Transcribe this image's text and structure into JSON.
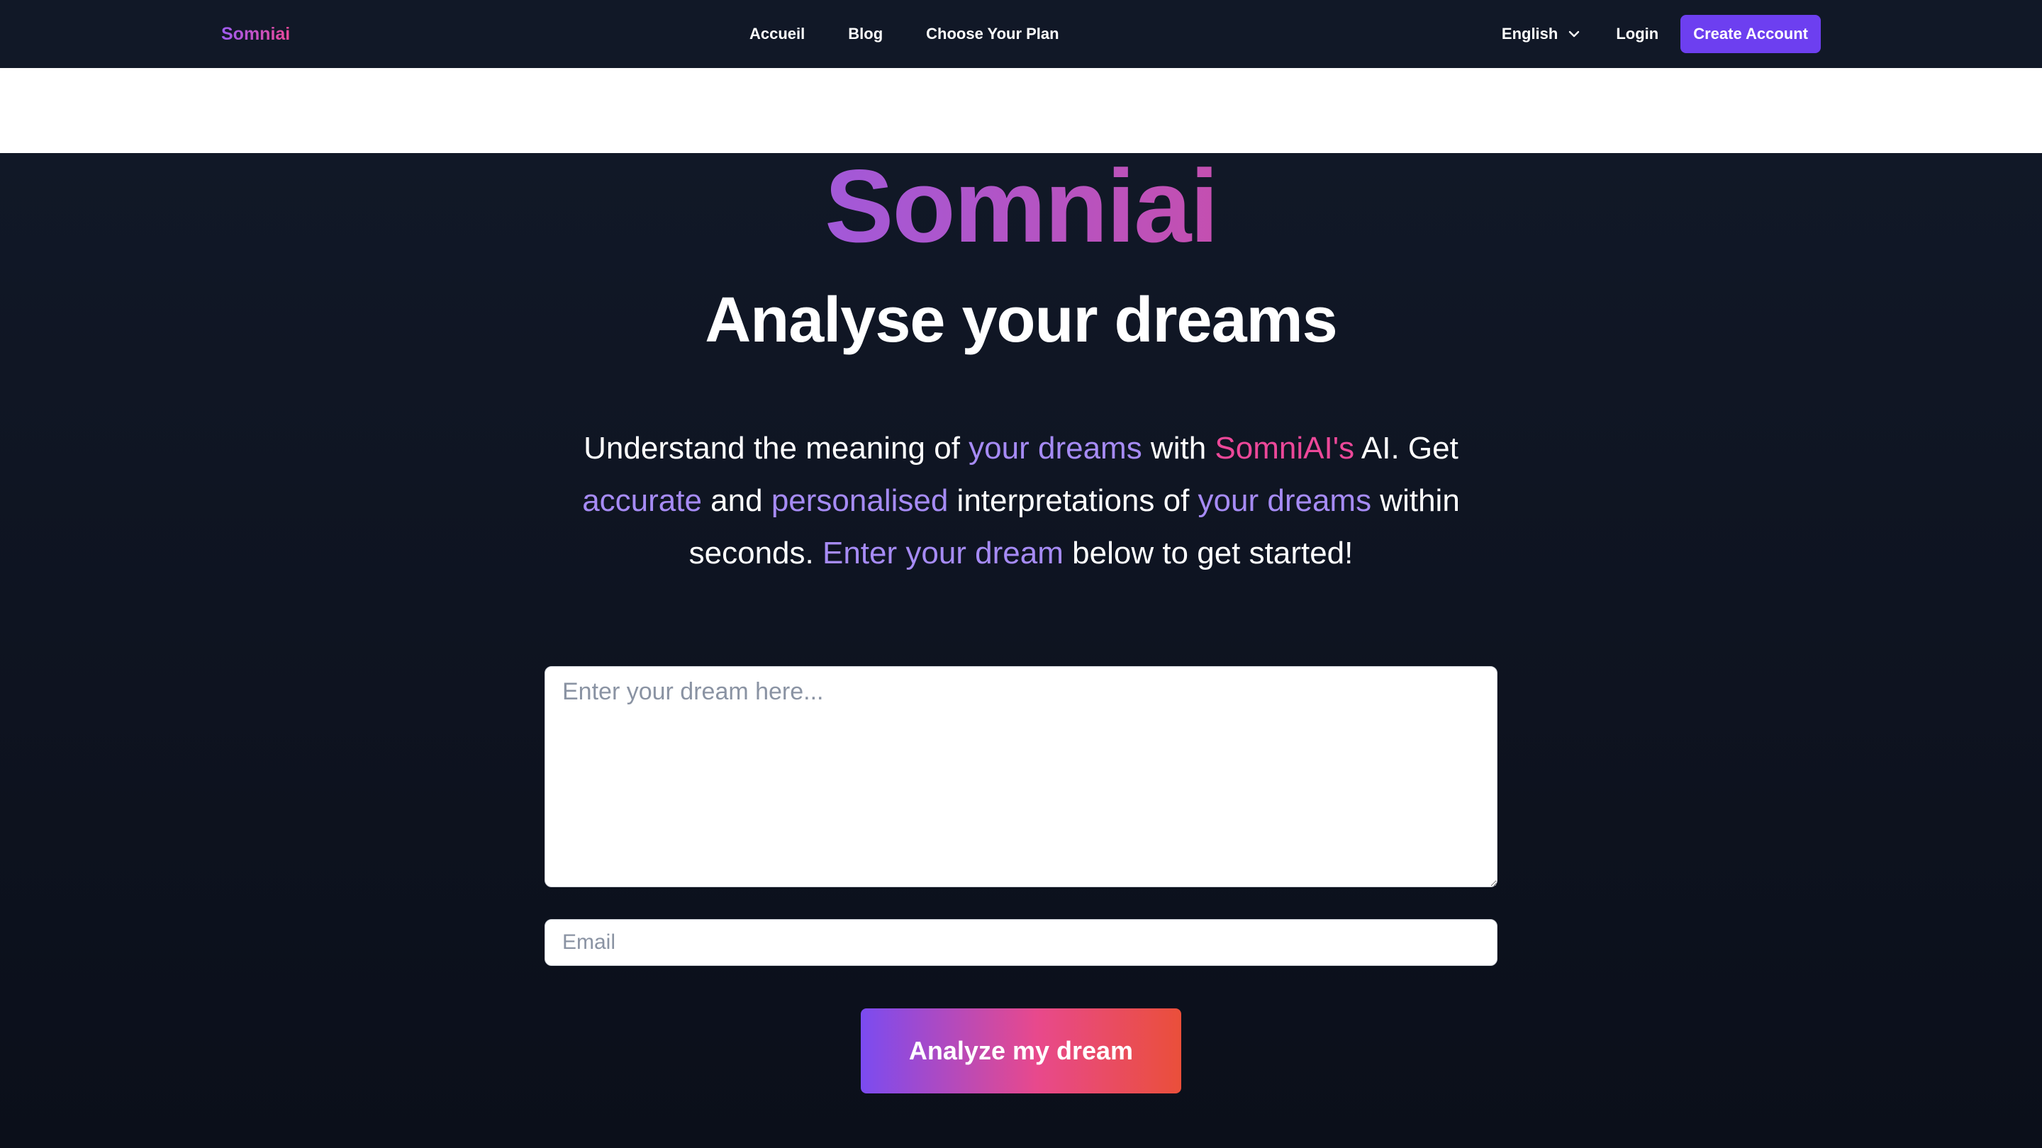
{
  "navbar": {
    "logo": "Somniai",
    "links": [
      "Accueil",
      "Blog",
      "Choose Your Plan"
    ],
    "language": "English",
    "login": "Login",
    "create_account": "Create Account"
  },
  "hero": {
    "brand": "Somniai",
    "title": "Analyse your dreams",
    "description": {
      "p1": "Understand the meaning of ",
      "h1": "your dreams",
      "p2": " with ",
      "h2": "SomniAI's",
      "p3": " AI. Get ",
      "h3": "accurate",
      "p4": " and ",
      "h4": "personalised",
      "p5": " interpretations of ",
      "h5": "your dreams",
      "p6": " within seconds. ",
      "h6": "Enter your dream",
      "p7": " below to get started!"
    },
    "dream_placeholder": "Enter your dream here...",
    "dream_value": "",
    "email_placeholder": "Email",
    "email_value": "",
    "submit_label": "Analyze my dream"
  },
  "colors": {
    "navbar_bg": "#111827",
    "accent_purple": "#6d3ff0",
    "highlight_purple": "#a68bf5",
    "highlight_pink": "#ec4899"
  },
  "icons": {
    "language_dropdown": "chevron-down-icon"
  }
}
